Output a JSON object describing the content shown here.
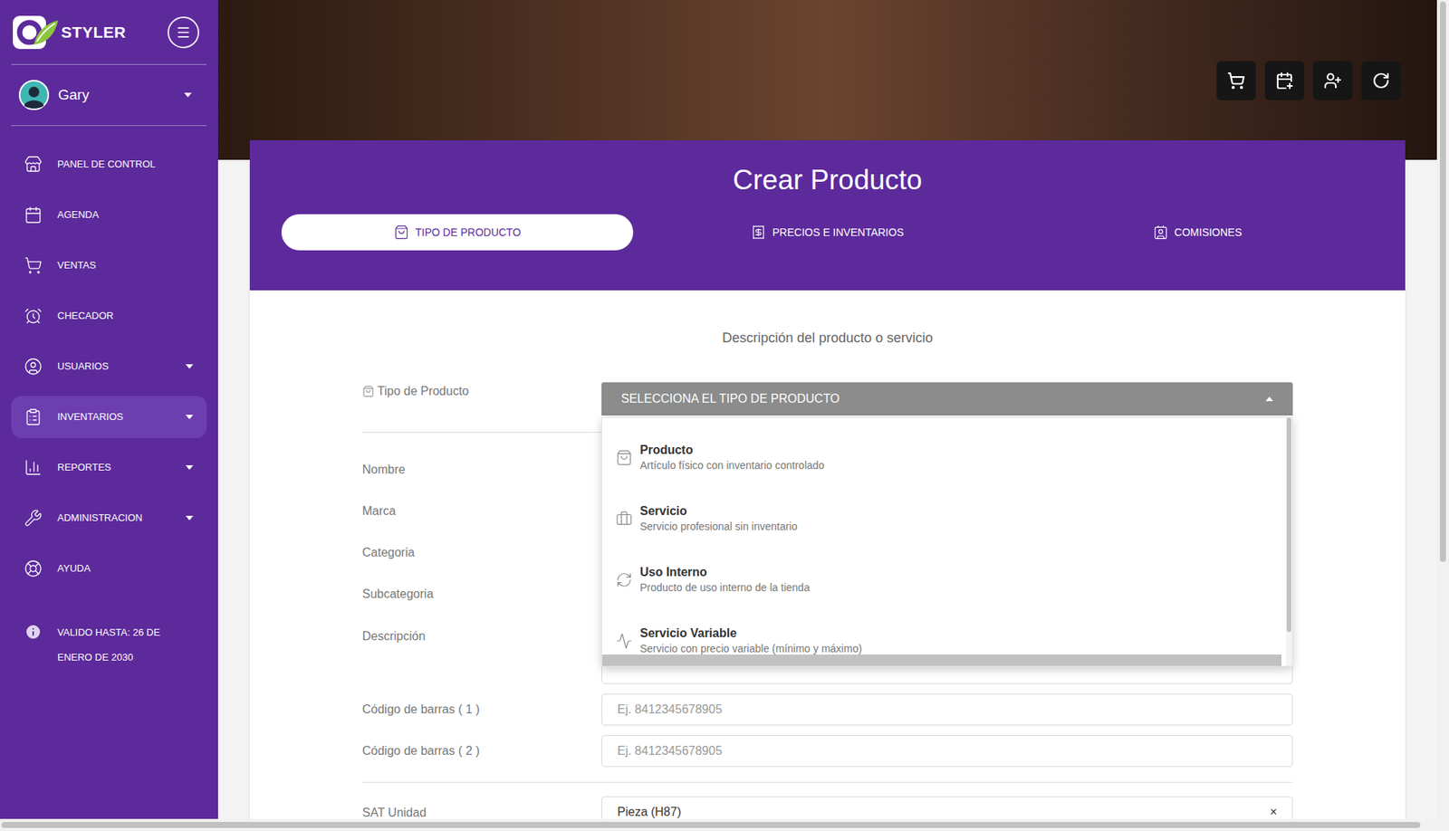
{
  "app": {
    "name": "STYLER"
  },
  "user": {
    "name": "Gary",
    "expanded": false
  },
  "sidebar": {
    "items": [
      {
        "label": "PANEL DE CONTROL",
        "expandable": false,
        "selected": false
      },
      {
        "label": "AGENDA",
        "expandable": false,
        "selected": false
      },
      {
        "label": "VENTAS",
        "expandable": false,
        "selected": false
      },
      {
        "label": "CHECADOR",
        "expandable": false,
        "selected": false
      },
      {
        "label": "USUARIOS",
        "expandable": true,
        "selected": false
      },
      {
        "label": "INVENTARIOS",
        "expandable": true,
        "selected": true
      },
      {
        "label": "REPORTES",
        "expandable": true,
        "selected": false
      },
      {
        "label": "ADMINISTRACION",
        "expandable": true,
        "selected": false
      },
      {
        "label": "AYUDA",
        "expandable": false,
        "selected": false
      }
    ],
    "license": "VALIDO HASTA: 26 DE ENERO DE 2030"
  },
  "form": {
    "title": "Crear Producto",
    "tabs": [
      {
        "label": "TIPO DE PRODUCTO",
        "selected": true
      },
      {
        "label": "PRECIOS E INVENTARIOS",
        "selected": false
      },
      {
        "label": "COMISIONES",
        "selected": false
      }
    ],
    "subtitle": "Descripción del producto o servicio",
    "type_select": {
      "label": "Tipo de Producto",
      "placeholder": "SELECCIONA EL TIPO DE PRODUCTO",
      "expanded": true,
      "options": [
        {
          "title": "Producto",
          "description": "Artículo físico con inventario controlado"
        },
        {
          "title": "Servicio",
          "description": "Servicio profesional sin inventario"
        },
        {
          "title": "Uso Interno",
          "description": "Producto de uso interno de la tienda"
        },
        {
          "title": "Servicio Variable",
          "description": "Servicio con precio variable (mínimo y máximo)"
        }
      ]
    },
    "fields": [
      {
        "label": "Nombre",
        "kind": "input",
        "placeholder": ""
      },
      {
        "label": "Marca",
        "kind": "input",
        "placeholder": ""
      },
      {
        "label": "Categoria",
        "kind": "input",
        "placeholder": ""
      },
      {
        "label": "Subcategoria",
        "kind": "input",
        "placeholder": ""
      },
      {
        "label": "Descripción",
        "kind": "textarea",
        "placeholder": ""
      },
      {
        "label": "Código de barras ( 1 )",
        "kind": "input",
        "placeholder": "Ej. 8412345678905"
      },
      {
        "label": "Código de barras ( 2 )",
        "kind": "input",
        "placeholder": "Ej. 8412345678905"
      }
    ],
    "sat_unit": {
      "label": "SAT Unidad",
      "value": "Pieza (H87)",
      "clear": "×"
    }
  }
}
